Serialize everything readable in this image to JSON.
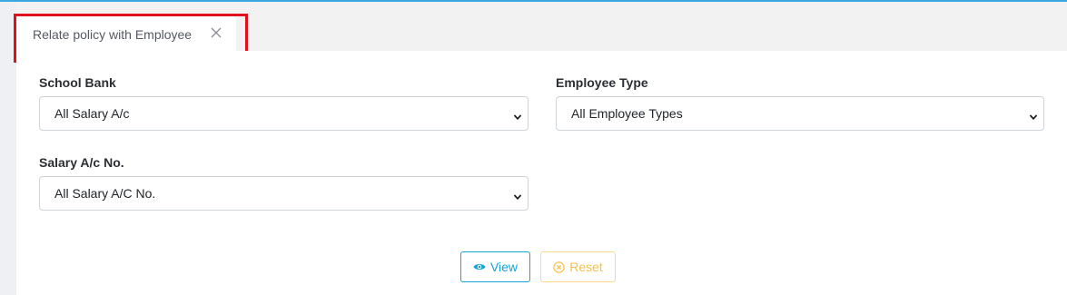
{
  "tab": {
    "title": "Relate policy with Employee",
    "close_icon": "close-icon"
  },
  "form": {
    "school_bank": {
      "label": "School Bank",
      "selected": "All Salary A/c"
    },
    "employee_type": {
      "label": "Employee Type",
      "selected": "All Employee Types"
    },
    "salary_ac_no": {
      "label": "Salary A/c No.",
      "selected": "All Salary A/C No."
    }
  },
  "actions": {
    "view_label": "View",
    "view_icon": "eye-icon",
    "reset_label": "Reset",
    "reset_icon": "circle-x-icon"
  },
  "colors": {
    "accent_blue": "#17a2d8",
    "reset_yellow": "#f6c04f",
    "highlight_red": "#e0101c",
    "top_rule": "#3aa7e0"
  }
}
